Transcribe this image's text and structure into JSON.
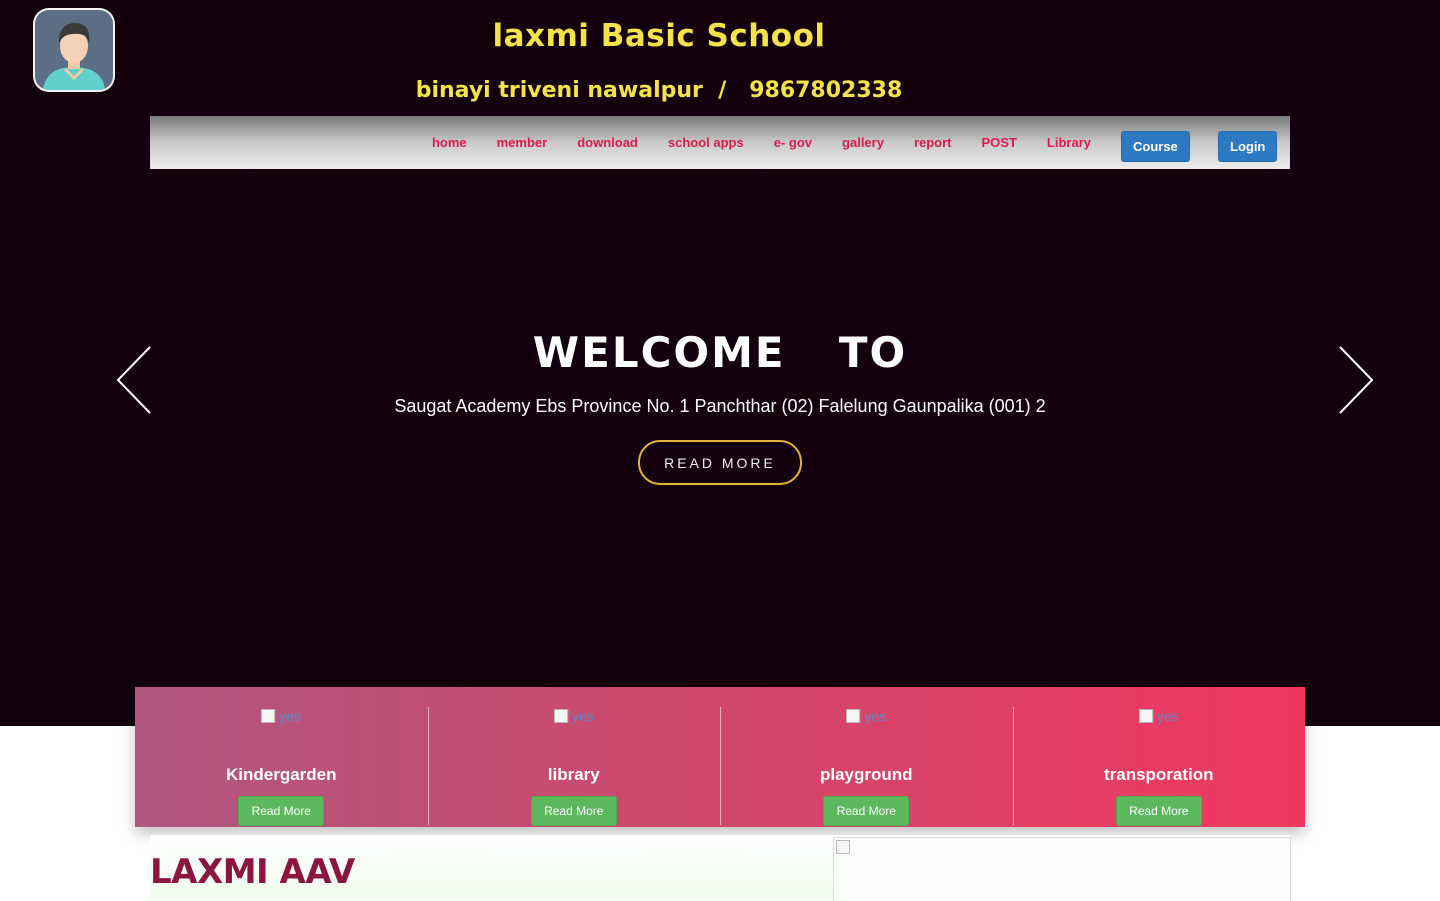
{
  "header": {
    "title": "laxmi Basic School",
    "subtitle": "binayi triveni nawalpur  /   9867802338",
    "logo_icon": "avatar-icon"
  },
  "nav": {
    "links": [
      "home",
      "member",
      "download",
      "school apps",
      "e- gov",
      "gallery",
      "report",
      "POST",
      "Library"
    ],
    "course_label": "Course",
    "login_label": "Login",
    "link_color": "#d81b50",
    "button_color": "#2d79c2"
  },
  "hero": {
    "heading": "WELCOME  TO",
    "description": "Saugat Academy Ebs Province No. 1 Panchthar (02) Falelung Gaunpalika (001) 2",
    "button_label": "READ MORE",
    "prev_icon": "chevron-left-icon",
    "next_icon": "chevron-right-icon",
    "background": "#14000d"
  },
  "features": [
    {
      "img_alt": "yes",
      "title": "Kindergarden",
      "button": "Read More"
    },
    {
      "img_alt": "yes",
      "title": "library",
      "button": "Read More"
    },
    {
      "img_alt": "yes",
      "title": "playground",
      "button": "Read More"
    },
    {
      "img_alt": "yes",
      "title": "transporation",
      "button": "Read More"
    }
  ],
  "about": {
    "heading": "LAXMI AAV"
  }
}
